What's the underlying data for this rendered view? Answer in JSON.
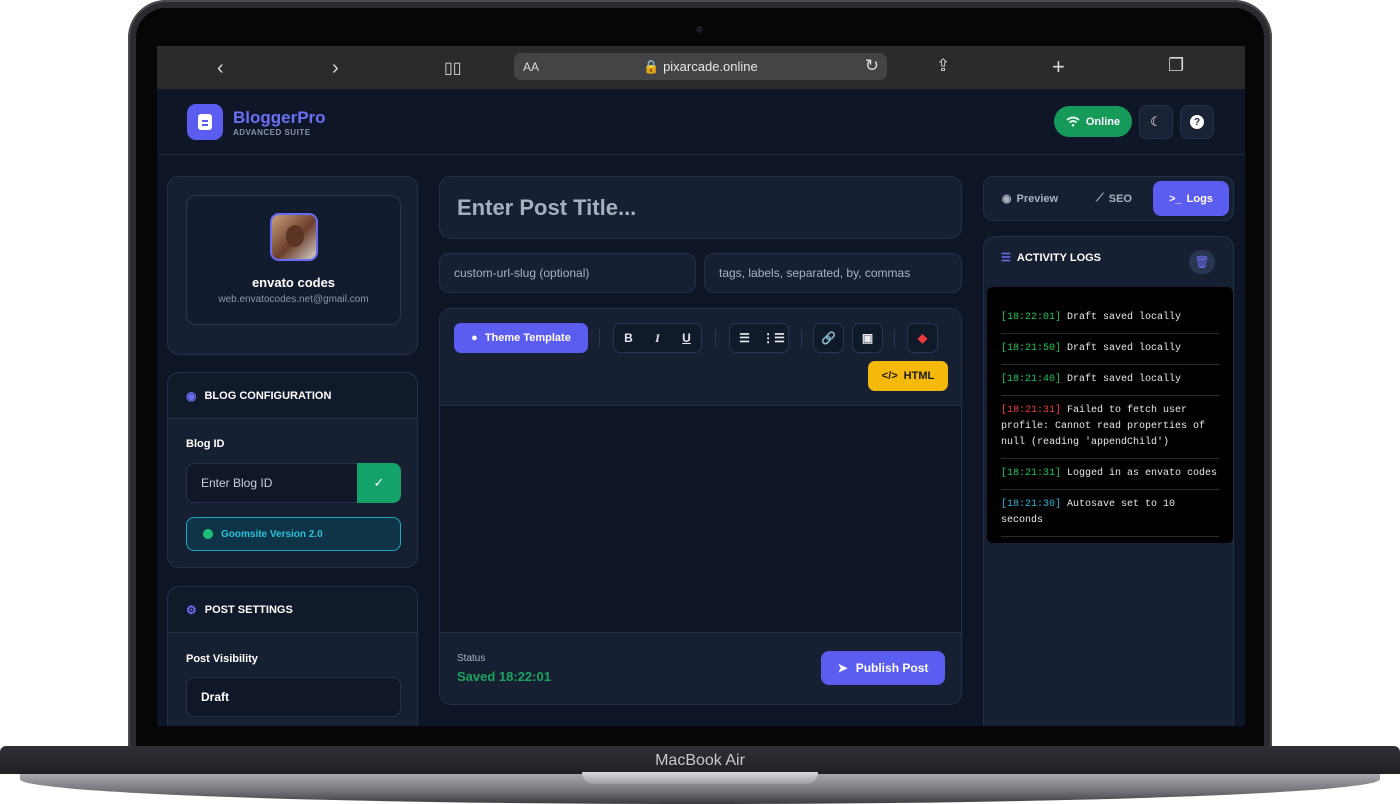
{
  "device": {
    "label": "MacBook Air"
  },
  "browser": {
    "text_size": "AA",
    "url": "pixarcade.online"
  },
  "header": {
    "brand": "BloggerPro",
    "subtitle": "ADVANCED SUITE",
    "online_label": "Online"
  },
  "profile": {
    "name": "envato codes",
    "email": "web.envatocodes.net@gmail.com"
  },
  "blog_config": {
    "title": "BLOG CONFIGURATION",
    "blog_id_label": "Blog ID",
    "blog_id_placeholder": "Enter Blog ID",
    "version": "Goomsite Version 2.0"
  },
  "post_settings": {
    "title": "POST SETTINGS",
    "visibility_label": "Post Visibility",
    "visibility_value": "Draft"
  },
  "editor": {
    "title_placeholder": "Enter Post Title...",
    "slug_placeholder": "custom-url-slug (optional)",
    "tags_placeholder": "tags, labels, separated, by, commas",
    "theme_template_label": "Theme Template",
    "bold": "B",
    "italic": "I",
    "underline": "U",
    "html_label": "HTML",
    "status_label": "Status",
    "status_value": "Saved 18:22:01",
    "publish_label": "Publish Post"
  },
  "tabs": {
    "preview": "Preview",
    "seo": "SEO",
    "logs": "Logs"
  },
  "logs": {
    "title": "ACTIVITY LOGS",
    "entries": [
      {
        "time": "[18:22:01]",
        "text": "Draft saved locally",
        "level": "ok"
      },
      {
        "time": "[18:21:50]",
        "text": "Draft saved locally",
        "level": "ok"
      },
      {
        "time": "[18:21:40]",
        "text": "Draft saved locally",
        "level": "ok"
      },
      {
        "time": "[18:21:31]",
        "text": "Failed to fetch user profile: Cannot read properties of null (reading 'appendChild')",
        "level": "err"
      },
      {
        "time": "[18:21:31]",
        "text": "Logged in as envato codes",
        "level": "ok"
      },
      {
        "time": "[18:21:30]",
        "text": "Autosave set to 10 seconds",
        "level": "info"
      }
    ]
  },
  "colors": {
    "accent": "#5b5cf0",
    "success": "#159a59",
    "warning": "#f5b90c",
    "error": "#ef3b3b"
  }
}
